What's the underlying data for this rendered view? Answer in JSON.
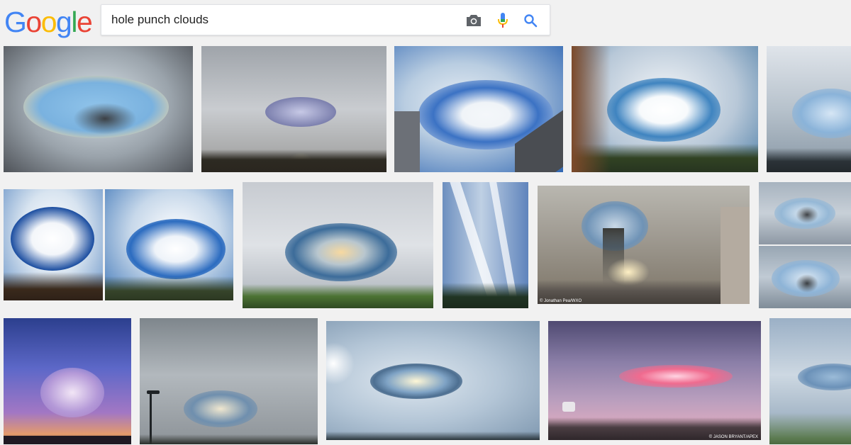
{
  "logo": {
    "letters": [
      {
        "char": "G",
        "color": "#4285f4"
      },
      {
        "char": "o",
        "color": "#ea4335"
      },
      {
        "char": "o",
        "color": "#fbbc05"
      },
      {
        "char": "g",
        "color": "#4285f4"
      },
      {
        "char": "l",
        "color": "#34a853"
      },
      {
        "char": "e",
        "color": "#ea4335"
      }
    ]
  },
  "search": {
    "query": "hole punch clouds",
    "icons": [
      "camera-icon",
      "microphone-icon",
      "search-icon"
    ]
  },
  "results": {
    "captions": {
      "jonathan": "© Jonathan Pea/WXO",
      "jason": "© JASON BRYANT/APEX"
    }
  },
  "colors": {
    "background": "#f1f1f1",
    "search_icon": "#4285f4",
    "camera_icon": "#5f6368"
  }
}
